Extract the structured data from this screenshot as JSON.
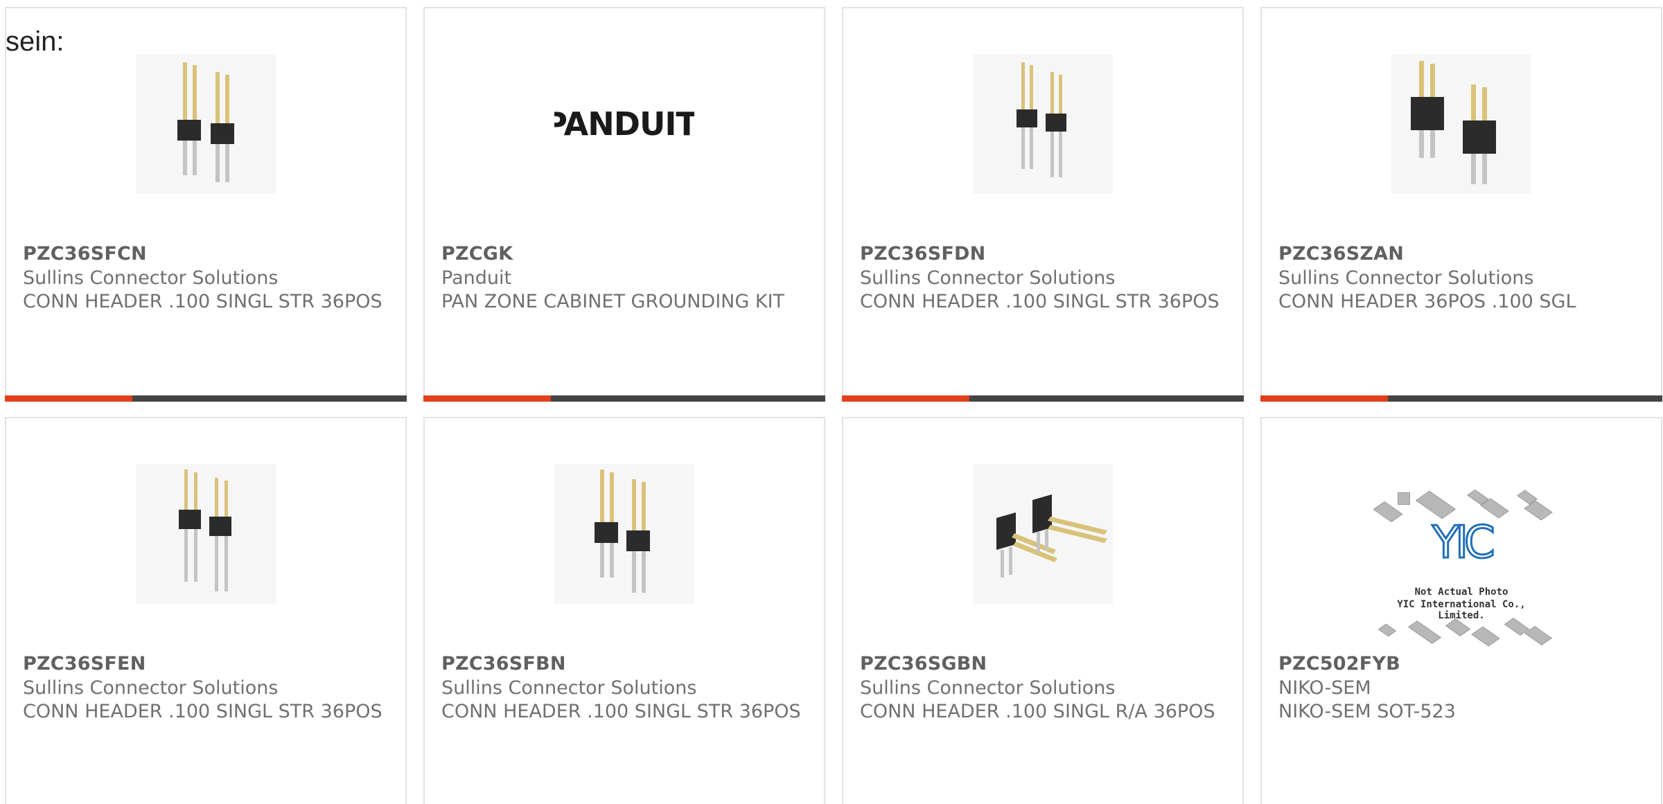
{
  "lead_text": "sein:",
  "colors": {
    "accent": "#e2401c",
    "bar": "#444444",
    "card_border": "#e2e2e2",
    "text": "#707070"
  },
  "products": [
    {
      "part": "PZC36SFCN",
      "manufacturer": "Sullins Connector Solutions",
      "description": "CONN HEADER .100 SINGL STR 36POS",
      "image": "straight-pin-header-icon"
    },
    {
      "part": "PZCGK",
      "manufacturer": "Panduit",
      "description": "PAN ZONE CABINET GROUNDING KIT",
      "image": "panduit-logo",
      "logo_text": "PANDUIT"
    },
    {
      "part": "PZC36SFDN",
      "manufacturer": "Sullins Connector Solutions",
      "description": "CONN HEADER .100 SINGL STR 36POS",
      "image": "straight-pin-header-icon"
    },
    {
      "part": "PZC36SZAN",
      "manufacturer": "Sullins Connector Solutions",
      "description": "CONN HEADER 36POS .100 SGL",
      "image": "straight-pin-header-icon"
    },
    {
      "part": "PZC36SFEN",
      "manufacturer": "Sullins Connector Solutions",
      "description": "CONN HEADER .100 SINGL STR 36POS",
      "image": "straight-pin-header-icon"
    },
    {
      "part": "PZC36SFBN",
      "manufacturer": "Sullins Connector Solutions",
      "description": "CONN HEADER .100 SINGL STR 36POS",
      "image": "straight-pin-header-icon"
    },
    {
      "part": "PZC36SGBN",
      "manufacturer": "Sullins Connector Solutions",
      "description": "CONN HEADER .100 SINGL R/A 36POS",
      "image": "right-angle-pin-header-icon"
    },
    {
      "part": "PZC502FYB",
      "manufacturer": "NIKO-SEM",
      "description": "NIKO-SEM SOT-523",
      "image": "yic-placeholder",
      "placeholder_mark": "YIC",
      "placeholder_line1": "Not Actual Photo",
      "placeholder_line2": "YIC International Co., Limited."
    }
  ]
}
